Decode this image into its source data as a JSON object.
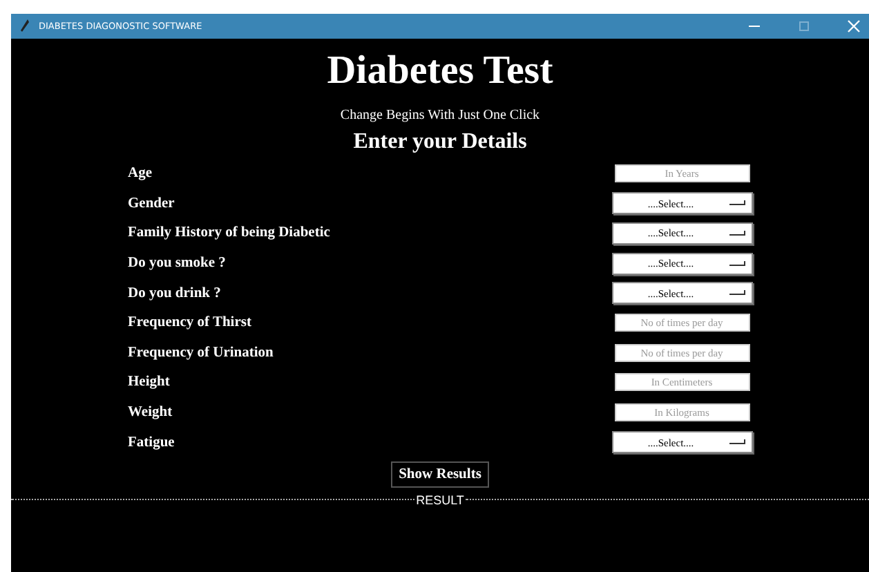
{
  "window": {
    "title": "DIABETES DIAGONOSTIC SOFTWARE"
  },
  "heading": "Diabetes Test",
  "tagline": "Change Begins With Just One Click",
  "form_title": "Enter your Details",
  "fields": [
    {
      "label": "Age",
      "kind": "entry",
      "placeholder": "In Years"
    },
    {
      "label": "Gender",
      "kind": "select",
      "value": "....Select...."
    },
    {
      "label": "Family History of being Diabetic",
      "kind": "select",
      "value": "....Select...."
    },
    {
      "label": "Do you smoke ?",
      "kind": "select",
      "value": "....Select...."
    },
    {
      "label": "Do you drink ?",
      "kind": "select",
      "value": "....Select...."
    },
    {
      "label": "Frequency of Thirst",
      "kind": "entry",
      "placeholder": "No of times per day"
    },
    {
      "label": "Frequency of Urination",
      "kind": "entry",
      "placeholder": "No of times per day"
    },
    {
      "label": "Height",
      "kind": "entry",
      "placeholder": "In Centimeters"
    },
    {
      "label": "Weight",
      "kind": "entry",
      "placeholder": "In Kilograms"
    },
    {
      "label": "Fatigue",
      "kind": "select",
      "value": "....Select...."
    }
  ],
  "submit_button": "Show Results",
  "result": {
    "label": "RESULT"
  }
}
